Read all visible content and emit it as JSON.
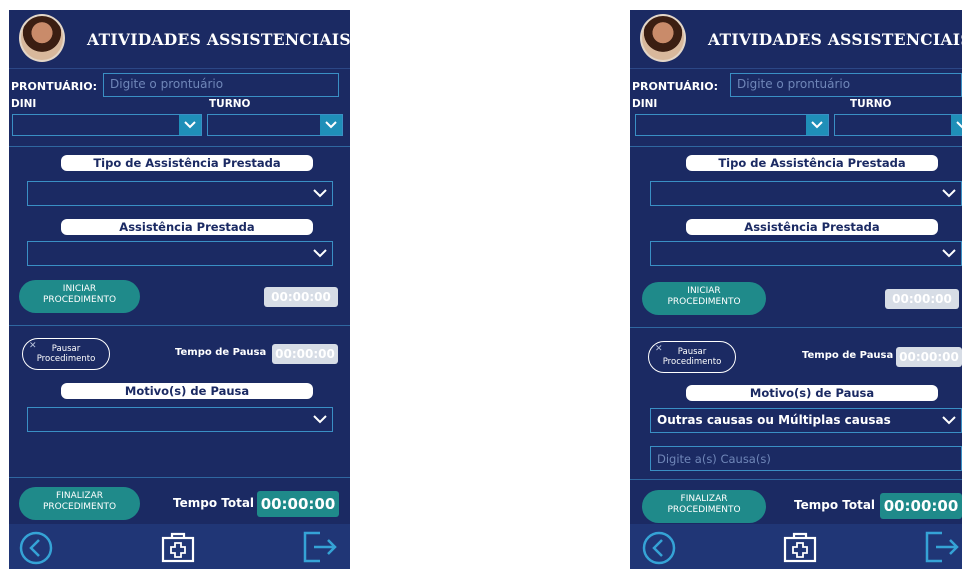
{
  "screens": [
    {
      "header": {
        "title": "ATIVIDADES ASSISTENCIAIS"
      },
      "prontuario": {
        "label": "PRONTUÁRIO:",
        "placeholder": "Digite o prontuário"
      },
      "dini": {
        "label": "DINI",
        "value": ""
      },
      "turno": {
        "label": "TURNO",
        "value": ""
      },
      "tipo_assistencia": {
        "label": "Tipo de Assistência Prestada",
        "value": ""
      },
      "assistencia": {
        "label": "Assistência Prestada",
        "value": ""
      },
      "iniciar": {
        "label_line1": "INICIAR",
        "label_line2": "PROCEDIMENTO",
        "timer": "00:00:00"
      },
      "pausa": {
        "button_line1": "Pausar",
        "button_line2": "Procedimento",
        "tempo_label": "Tempo de Pausa",
        "timer": "00:00:00"
      },
      "motivo": {
        "label": "Motivo(s) de Pausa",
        "value": ""
      },
      "finalizar": {
        "label_line1": "FINALIZAR",
        "label_line2": "PROCEDIMENTO",
        "tempo_label": "Tempo Total",
        "timer": "00:00:00"
      }
    },
    {
      "header": {
        "title": "ATIVIDADES ASSISTENCIAIS"
      },
      "prontuario": {
        "label": "PRONTUÁRIO:",
        "placeholder": "Digite o prontuário"
      },
      "dini": {
        "label": "DINI",
        "value": ""
      },
      "turno": {
        "label": "TURNO",
        "value": ""
      },
      "tipo_assistencia": {
        "label": "Tipo de Assistência Prestada",
        "value": ""
      },
      "assistencia": {
        "label": "Assistência Prestada",
        "value": ""
      },
      "iniciar": {
        "label_line1": "INICIAR",
        "label_line2": "PROCEDIMENTO",
        "timer": "00:00:00"
      },
      "pausa": {
        "button_line1": "Pausar",
        "button_line2": "Procedimento",
        "tempo_label": "Tempo de Pausa",
        "timer": "00:00:00"
      },
      "motivo": {
        "label": "Motivo(s) de Pausa",
        "value": "Outras causas ou Múltiplas causas"
      },
      "causa": {
        "placeholder": "Digite a(s) Causa(s)"
      },
      "finalizar": {
        "label_line1": "FINALIZAR",
        "label_line2": "PROCEDIMENTO",
        "tempo_label": "Tempo Total",
        "timer": "00:00:00"
      }
    }
  ],
  "icons": {
    "back": "back-circle-icon",
    "center": "medical-kit-icon",
    "exit": "exit-icon",
    "chevron": "chevron-down-icon",
    "close": "close-icon"
  },
  "colors": {
    "background": "#1b2a63",
    "accent": "#1f8a8a",
    "border": "#3a8fc4",
    "navbar": "#203676",
    "icon": "#35a3d6"
  }
}
